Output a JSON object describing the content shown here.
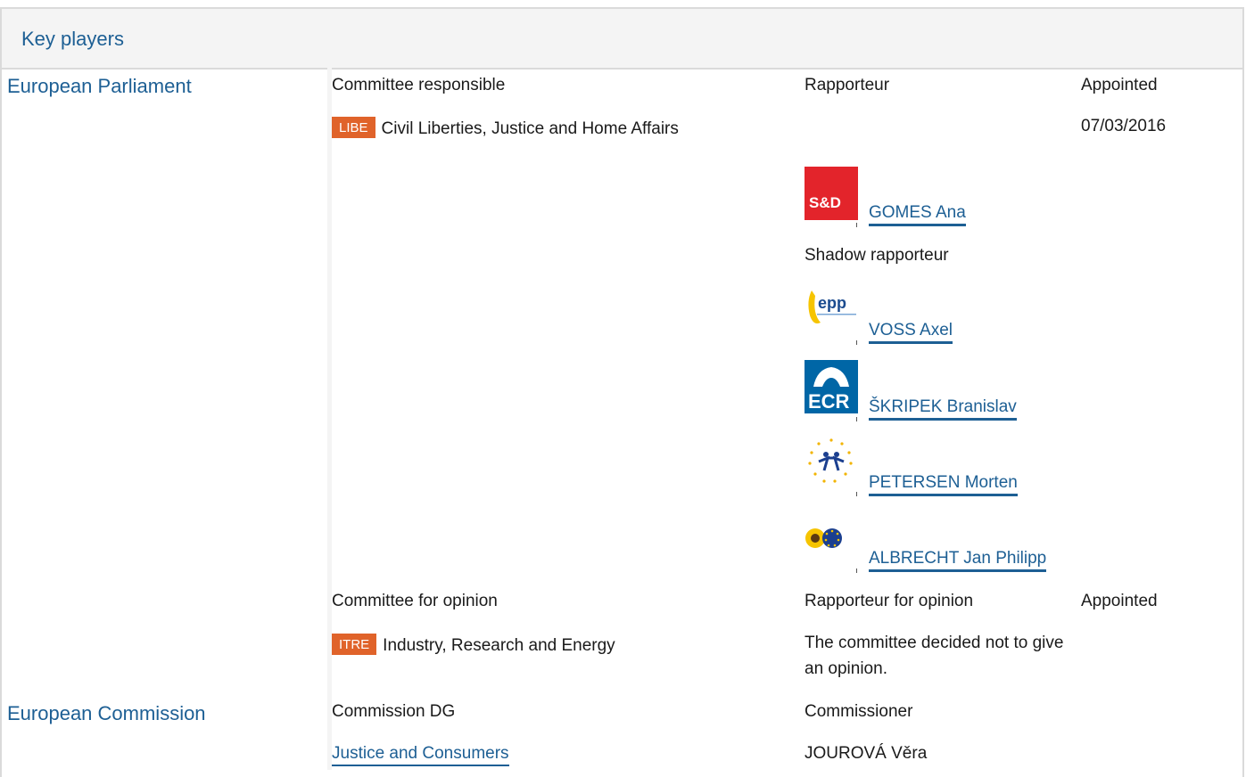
{
  "header": {
    "title": "Key players"
  },
  "parliament": {
    "institution": "European Parliament",
    "col_committee": "Committee responsible",
    "col_rapporteur": "Rapporteur",
    "col_appointed": "Appointed",
    "committee_code": "LIBE",
    "committee_name": "Civil Liberties, Justice and Home Affairs",
    "appointed_date": "07/03/2016",
    "rapporteur": {
      "name": "GOMES Ana",
      "group_logo_text": "S&D",
      "group_color": "#e3242b"
    },
    "shadow_label": "Shadow rapporteur",
    "shadows": [
      {
        "name": "VOSS Axel",
        "logo": "epp-logo-icon",
        "logo_text": "epp"
      },
      {
        "name": "ŠKRIPEK Branislav",
        "logo": "ecr-logo-icon",
        "logo_text": "ECR"
      },
      {
        "name": "PETERSEN Morten",
        "logo": "alde-logo-icon"
      },
      {
        "name": "ALBRECHT Jan Philipp",
        "logo": "greens-efa-logo-icon"
      }
    ],
    "opinion": {
      "col_committee": "Committee for opinion",
      "col_rapporteur": "Rapporteur for opinion",
      "col_appointed": "Appointed",
      "committee_code": "ITRE",
      "committee_name": "Industry, Research and Energy",
      "note": "The committee decided not to give an opinion."
    }
  },
  "commission": {
    "institution": "European Commission",
    "col_dg": "Commission DG",
    "col_commissioner": "Commissioner",
    "dg": "Justice and Consumers",
    "commissioner": "JOUROVÁ Věra"
  },
  "colors": {
    "accent": "#1d5f94",
    "badge": "#e0632a",
    "header_bg": "#f4f4f4",
    "border": "#dadada"
  }
}
